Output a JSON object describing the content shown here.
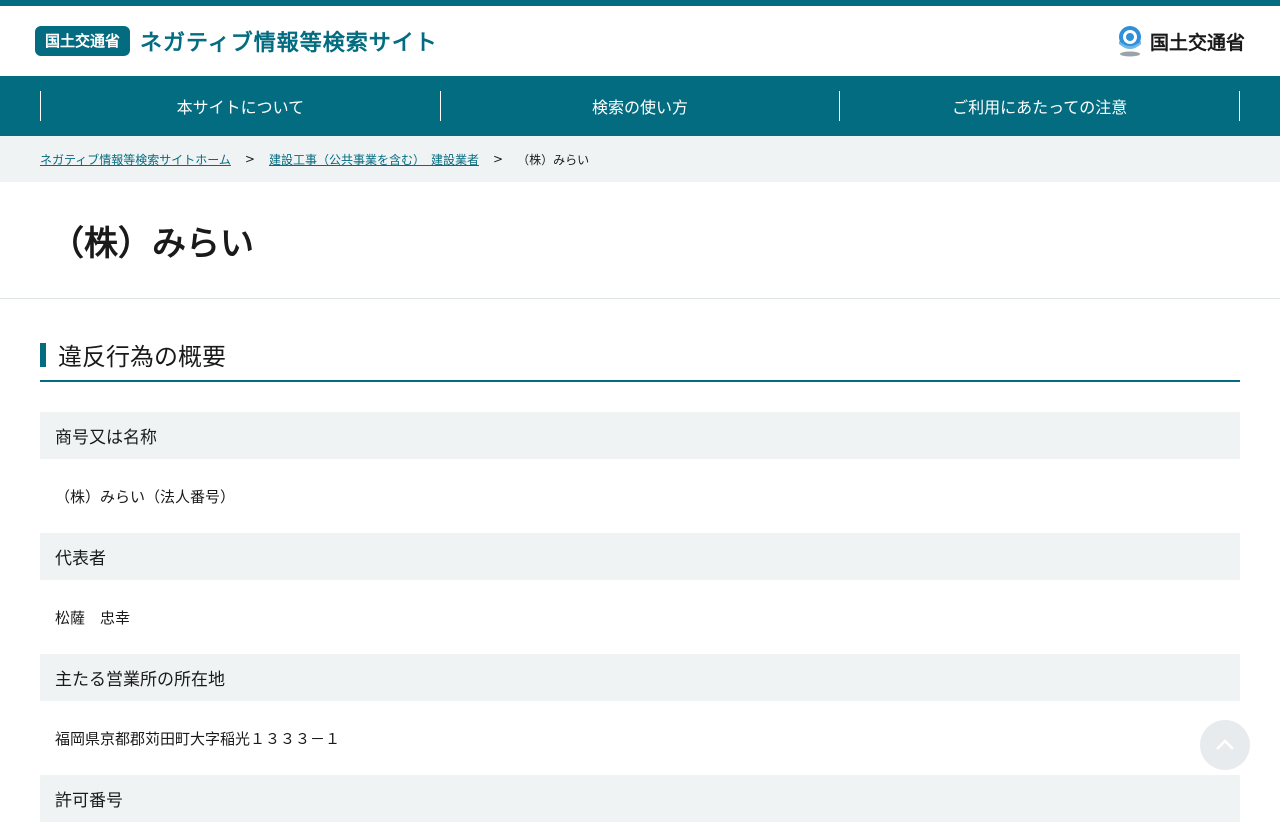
{
  "header": {
    "badge": "国土交通省",
    "site_title": "ネガティブ情報等検索サイト",
    "logo_text": "国土交通省"
  },
  "nav": {
    "items": [
      {
        "label": "本サイトについて"
      },
      {
        "label": "検索の使い方"
      },
      {
        "label": "ご利用にあたっての注意"
      }
    ]
  },
  "breadcrumb": {
    "home": "ネガティブ情報等検索サイトホーム",
    "category": "建設工事（公共事業を含む）　建設業者",
    "current": "（株）みらい",
    "separator": ">"
  },
  "page": {
    "title": "（株）みらい"
  },
  "section": {
    "heading": "違反行為の概要",
    "fields": [
      {
        "label": "商号又は名称",
        "value": "（株）みらい（法人番号）"
      },
      {
        "label": "代表者",
        "value": "松薩　忠幸"
      },
      {
        "label": "主たる営業所の所在地",
        "value": "福岡県京都郡苅田町大字稲光１３３３－１"
      },
      {
        "label": "許可番号",
        "value": ""
      }
    ]
  },
  "colors": {
    "brand": "#036c80",
    "row_bg": "#eff3f4"
  }
}
